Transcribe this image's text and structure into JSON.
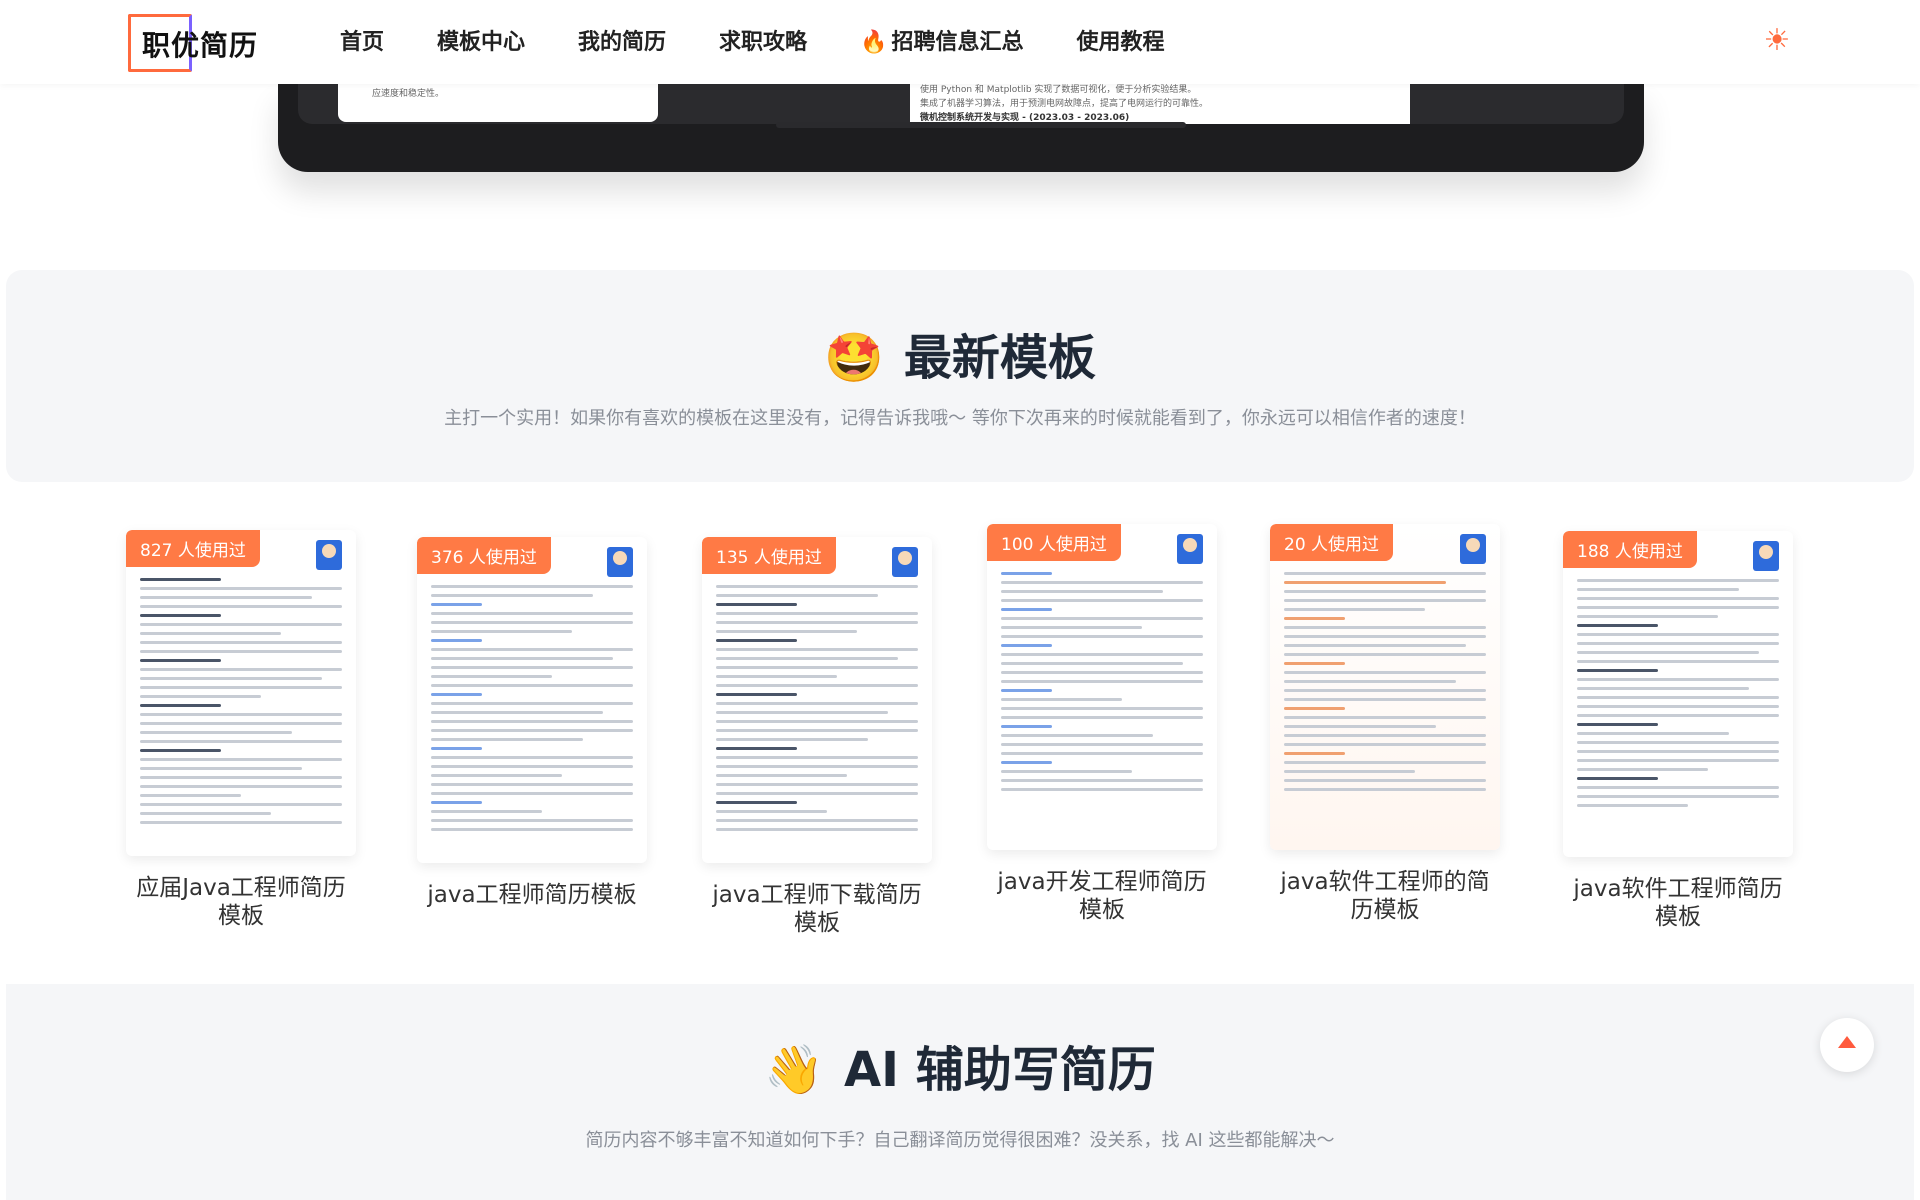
{
  "header": {
    "logo_text": "职优简历",
    "nav": [
      {
        "label": "首页"
      },
      {
        "label": "模板中心"
      },
      {
        "label": "我的简历"
      },
      {
        "label": "求职攻略"
      },
      {
        "label": "招聘信息汇总",
        "icon": "fire-icon"
      },
      {
        "label": "使用教程"
      }
    ],
    "theme_icon": "sun-icon"
  },
  "laptop_preview": {
    "line1": "应速度和稳定性。",
    "line2": "使用 Python 和 Matplotlib 实现了数据可视化，便于分析实验结果。",
    "line3": "集成了机器学习算法，用于预测电网故障点，提高了电网运行的可靠性。",
    "line4": "微机控制系统开发与实现 - (2023.03 - 2023.06)"
  },
  "latest": {
    "title": "最新模板",
    "subtitle": "主打一个实用！如果你有喜欢的模板在这里没有，记得告诉我哦～ 等你下次再来的时候就能看到了，你永远可以相信作者的速度！",
    "cards": [
      {
        "badge": "827 人使用过",
        "caption": "应届Java工程师简历模板"
      },
      {
        "badge": "376 人使用过",
        "caption": "java工程师简历模板"
      },
      {
        "badge": "135 人使用过",
        "caption": "java工程师下载简历模板"
      },
      {
        "badge": "100 人使用过",
        "caption": "java开发工程师简历模板"
      },
      {
        "badge": "20 人使用过",
        "caption": "java软件工程师的简历模板"
      },
      {
        "badge": "188 人使用过",
        "caption": "java软件工程师简历模板"
      }
    ]
  },
  "ai": {
    "title": "AI 辅助写简历",
    "subtitle": "简历内容不够丰富不知道如何下手？自己翻译简历觉得很困难？没关系，找 AI 这些都能解决～"
  }
}
